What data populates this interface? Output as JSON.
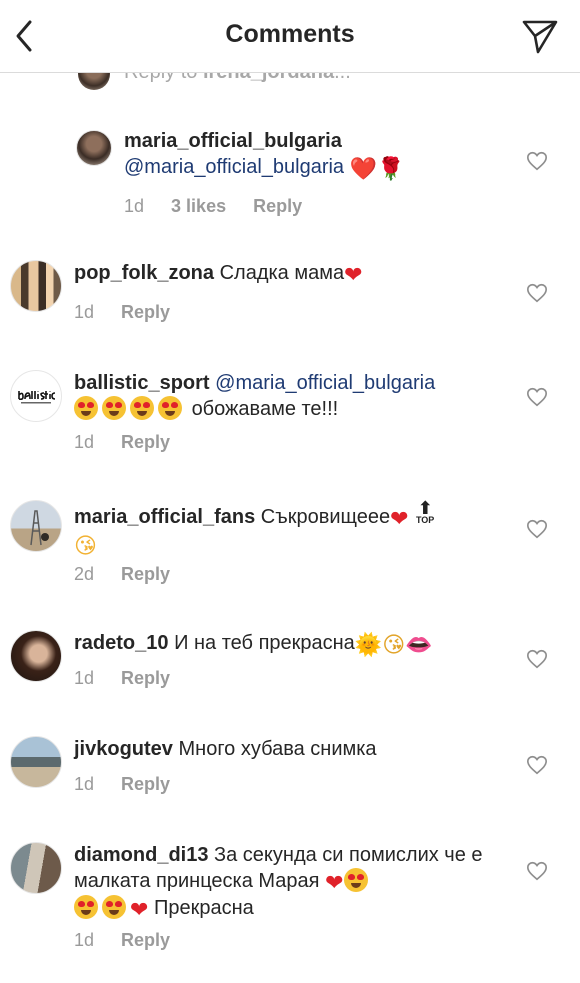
{
  "header": {
    "title": "Comments",
    "back_icon": "chevron-left-icon",
    "send_icon": "direct-send-icon"
  },
  "reply_peek": {
    "prefix": "Reply to ",
    "target": "irena_jordana",
    "suffix": "..."
  },
  "comments": [
    {
      "username": "maria_official_bulgaria",
      "mention": "@maria_official_bulgaria",
      "text": "",
      "emoji": "❤️🌹",
      "time": "1d",
      "likes": "3 likes",
      "reply": "Reply"
    },
    {
      "username": "pop_folk_zona",
      "text": "Сладка мама",
      "emoji": "❤",
      "time": "1d",
      "reply": "Reply"
    },
    {
      "username": "ballistic_sport",
      "mention": "@maria_official_bulgaria",
      "text": "обожаваме те!!!",
      "time": "1d",
      "reply": "Reply"
    },
    {
      "username": "maria_official_fans",
      "text": "Съкровищеее",
      "top_label": "TOP",
      "time": "2d",
      "reply": "Reply"
    },
    {
      "username": "radeto_10",
      "text": "И на теб прекрасна",
      "emoji": "🌞😘👄",
      "time": "1d",
      "reply": "Reply"
    },
    {
      "username": "jivkogutev",
      "text": "Много хубава снимка",
      "time": "1d",
      "reply": "Reply"
    },
    {
      "username": "diamond_di13",
      "text": "За секунда си помислих че е малката принцеска Марая",
      "text2": "Прекрасна",
      "time": "1d",
      "reply": "Reply"
    }
  ],
  "colors": {
    "mention": "#1f3b73",
    "muted": "#9a9a9a",
    "heart": "#e0222a"
  }
}
